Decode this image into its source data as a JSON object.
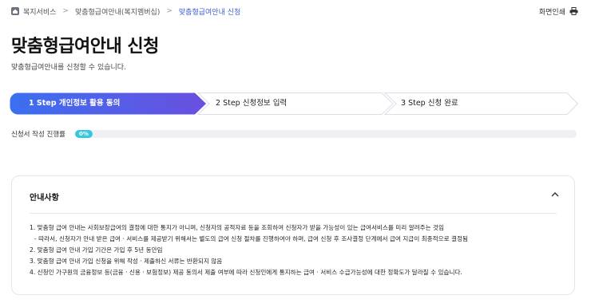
{
  "breadcrumb": {
    "items": [
      "복지서비스",
      "맞춤형급여안내(복지멤버십)",
      "맞춤형급여안내 신청"
    ],
    "separator": ">"
  },
  "print_label": "화면인쇄",
  "page": {
    "title": "맞춤형급여안내 신청",
    "subtitle": "맞춤형급여안내를 신청할 수 있습니다."
  },
  "steps": [
    {
      "label": "1 Step 개인정보 활용 동의",
      "active": true
    },
    {
      "label": "2 Step 신청정보 입력",
      "active": false
    },
    {
      "label": "3 Step 신청 완료",
      "active": false
    }
  ],
  "progress": {
    "label": "신청서 작성 진행률",
    "value_text": "0%",
    "value": 0
  },
  "notice": {
    "title": "안내사항",
    "items": [
      "1. 맞춤형 급여 안내는 사회보장급여의 결정에 대한 통지가 아니며, 신청자의 공적자료 등을 조회하여 신청자가 받을 가능성이 있는 급여서비스를 미리 알려주는 것임",
      "- 따라서, 신청자가 안내 받은 급여 · 서비스를 제공받기 위해서는 별도의 급여 신청 절차를 진행하여야 하며, 급여 신청 후 조사결정 단계에서 급여 지급이 최종적으로 결정됨",
      "2. 맞춤형 급여 안내 가입 기간은 가입 후 5년 동안임",
      "3. 맞춤형 급여 안내 가입 신청을 위해 작성 · 제출하신 서류는 반환되지 않음",
      "4. 신청인 가구원의 금융정보 등(금융 · 신용 · 보험정보) 제공 동의서 제출 여부에 따라 신청인에게 통지하는 급여 · 서비스 수급가능성에 대한 정확도가 달라질 수 있습니다."
    ]
  },
  "colors": {
    "accent": "#4a5fe0",
    "progress": "#39c7e0"
  }
}
